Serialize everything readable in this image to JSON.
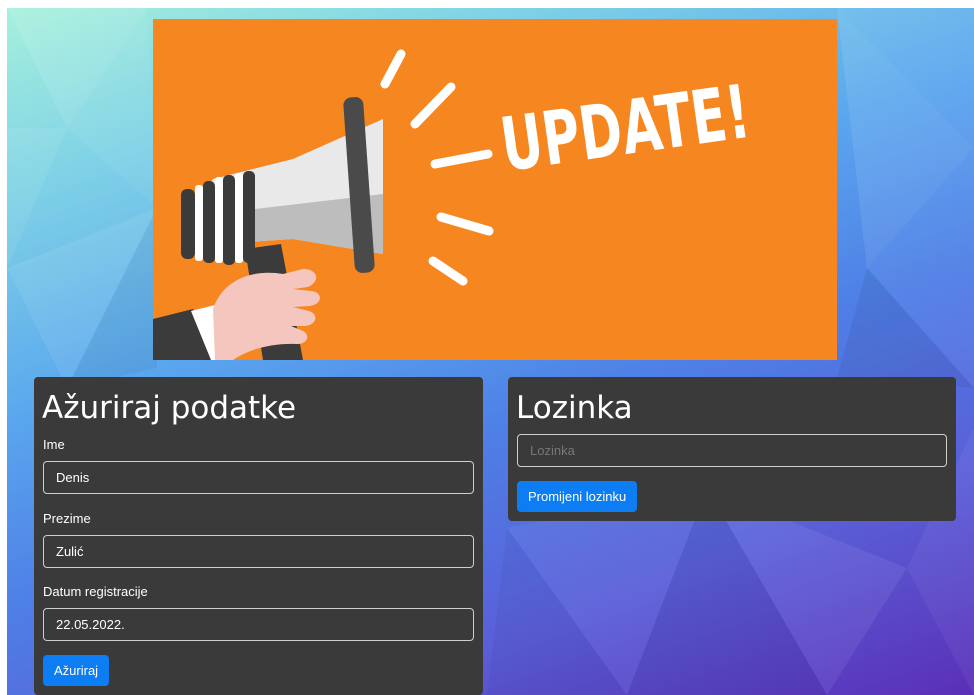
{
  "banner": {
    "text": "UPDATE!",
    "bg_color": "#f6861f"
  },
  "profile_form": {
    "title": "Ažuriraj podatke",
    "first_name": {
      "label": "Ime",
      "value": "Denis"
    },
    "last_name": {
      "label": "Prezime",
      "value": "Zulić"
    },
    "registration_date": {
      "label": "Datum registracije",
      "value": "22.05.2022."
    },
    "submit_label": "Ažuriraj"
  },
  "password_form": {
    "title": "Lozinka",
    "password": {
      "placeholder": "Lozinka",
      "value": ""
    },
    "submit_label": "Promijeni lozinku"
  },
  "colors": {
    "card_bg": "#3a3a3a",
    "button": "#0d7df3",
    "text": "#ffffff"
  }
}
